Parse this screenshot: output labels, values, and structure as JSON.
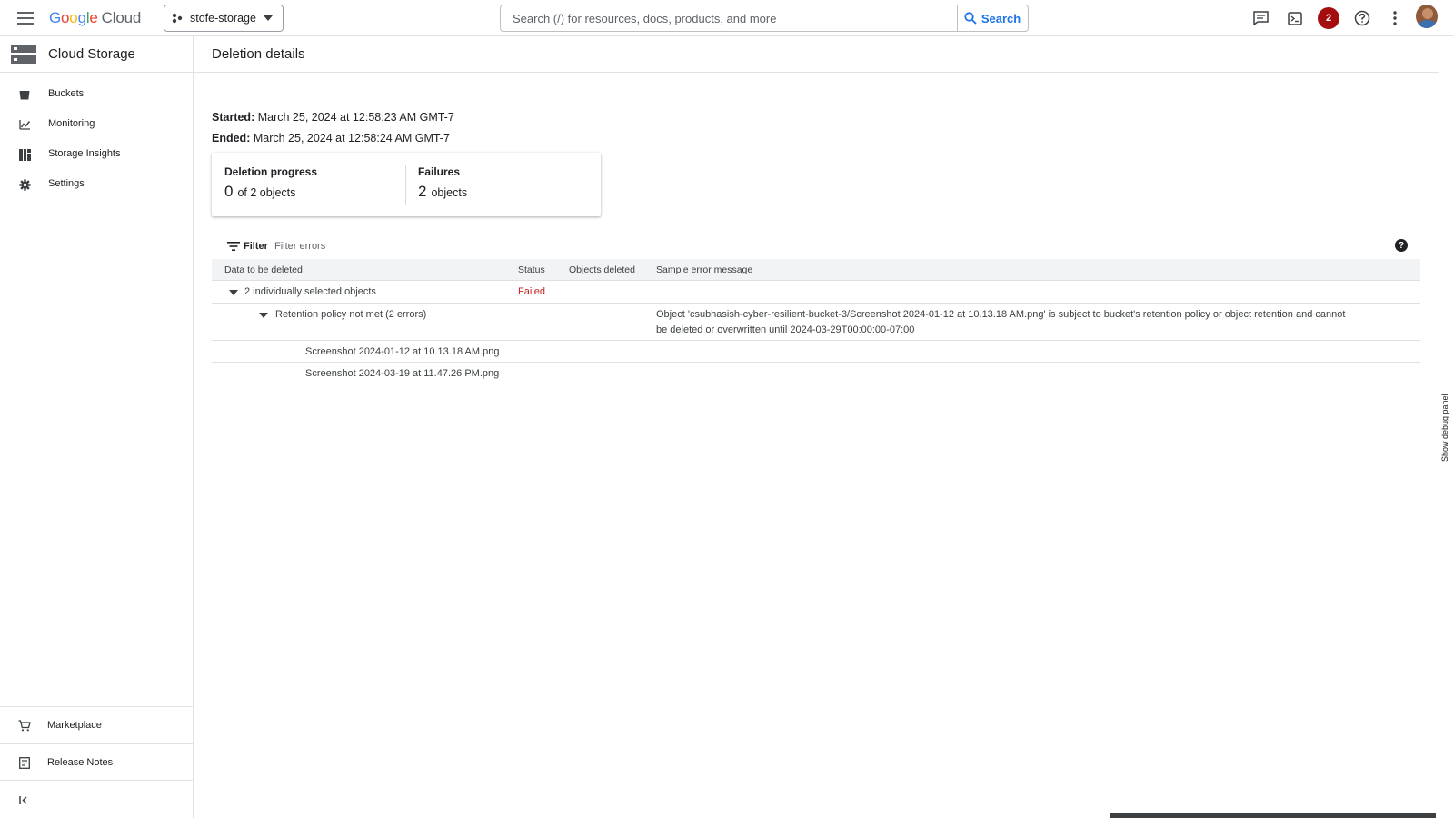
{
  "topbar": {
    "logo_google": "Google",
    "logo_cloud": "Cloud",
    "project": "stofe-storage",
    "search_placeholder": "Search (/) for resources, docs, products, and more",
    "search_button": "Search",
    "notifications_count": "2"
  },
  "sidebar": {
    "product_title": "Cloud Storage",
    "items": [
      {
        "label": "Buckets",
        "icon": "bucket-icon"
      },
      {
        "label": "Monitoring",
        "icon": "chart-icon"
      },
      {
        "label": "Storage Insights",
        "icon": "insights-icon"
      },
      {
        "label": "Settings",
        "icon": "gear-icon"
      }
    ],
    "bottom_items": [
      {
        "label": "Marketplace",
        "icon": "cart-icon"
      },
      {
        "label": "Release Notes",
        "icon": "notes-icon"
      }
    ]
  },
  "page": {
    "title": "Deletion details",
    "started_label": "Started:",
    "started_value": " March 25, 2024 at 12:58:23 AM GMT-7",
    "ended_label": "Ended:",
    "ended_value": " March 25, 2024 at 12:58:24 AM GMT-7",
    "debug_panel": "Show debug panel"
  },
  "summary": {
    "progress_title": "Deletion progress",
    "progress_value": "0",
    "progress_unit": "of 2 objects",
    "failures_title": "Failures",
    "failures_value": "2",
    "failures_unit": "objects"
  },
  "filter": {
    "label": "Filter",
    "placeholder": "Filter errors"
  },
  "table": {
    "columns": [
      "Data to be deleted",
      "Status",
      "Objects deleted",
      "Sample error message"
    ],
    "group_label": "2 individually selected objects",
    "group_status": "Failed",
    "error_group_label": "Retention policy not met (2 errors)",
    "error_message": "Object 'csubhasish-cyber-resilient-bucket-3/Screenshot 2024-01-12 at 10.13.18 AM.png' is subject to bucket's retention policy or object retention and cannot be deleted or overwritten until 2024-03-29T00:00:00-07:00",
    "files": [
      "Screenshot 2024-01-12 at 10.13.18 AM.png",
      "Screenshot 2024-03-19 at 11.47.26 PM.png"
    ]
  },
  "colors": {
    "accent": "#1a73e8",
    "failed": "#c5221f",
    "badge": "#a50e0e"
  }
}
